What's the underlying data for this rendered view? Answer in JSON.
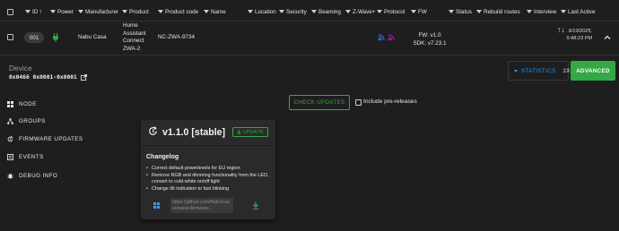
{
  "table": {
    "columns": [
      "ID",
      "Power",
      "Manufacturer",
      "Product",
      "Product code",
      "Name",
      "Location",
      "Security",
      "Beaming",
      "Z-Wave+",
      "Protocol",
      "FW",
      "Status",
      "Rebuild routes",
      "Interview",
      "Last Active"
    ],
    "row": {
      "id": "001",
      "manufacturer": "Nabu Casa",
      "product": [
        "Home",
        "Assistant",
        "Connect",
        "ZWA-2"
      ],
      "product_code": "NC-ZWA-9734",
      "fw": "FW: v1.0",
      "sdk": "SDK: v7.23.1",
      "last_active": [
        "9/13/2025,",
        "5:48:23 PM"
      ],
      "protocol_colors": [
        "#2979ff",
        "#d500f9"
      ]
    }
  },
  "device": {
    "label": "Device",
    "ids": "0x0466 0x0001-0x0001"
  },
  "actions": {
    "statistics_label": "STATISTICS",
    "statistics_count": "2X",
    "advanced_label": "ADVANCED"
  },
  "nav": [
    {
      "label": "NODE",
      "icon": "node-icon"
    },
    {
      "label": "GROUPS",
      "icon": "groups-icon"
    },
    {
      "label": "FIRMWARE UPDATES",
      "icon": "firmware-icon"
    },
    {
      "label": "EVENTS",
      "icon": "events-icon"
    },
    {
      "label": "DEBUG INFO",
      "icon": "debug-icon"
    }
  ],
  "updates": {
    "check_label": "CHECK UPDATES",
    "prerelease_label": "Include pre-releases"
  },
  "card": {
    "title": "v1.1.0 [stable]",
    "update_label": "UPDATE",
    "changelog_title": "Changelog",
    "changelog": [
      "Correct default powerlevels for EU region",
      "Remove RGB and dimming functionality from the LED, convert to cold-white on/off light",
      "Change tilt indication to fast blinking"
    ],
    "link": "https://github.com/NabuCasa/zwave-firmware..."
  },
  "colors": {
    "accent_green": "#33a844",
    "accent_blue": "#2196f3",
    "background": "#1e1e1e",
    "card": "#2a2a2a"
  }
}
